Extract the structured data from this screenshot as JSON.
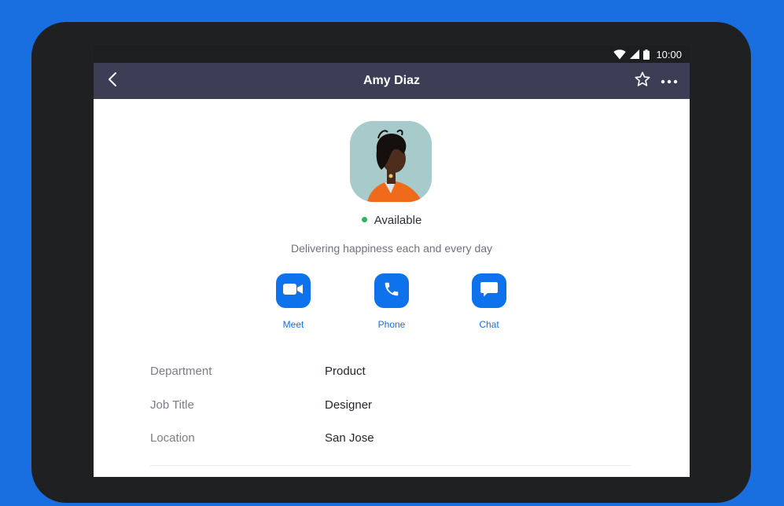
{
  "status_bar": {
    "time": "10:00",
    "icons": [
      "wifi-icon",
      "signal-icon",
      "battery-icon"
    ]
  },
  "header": {
    "title": "Amy Diaz",
    "back_icon": "chevron-left-icon",
    "star_icon": "star-outline-icon",
    "more_icon": "more-horizontal-icon"
  },
  "profile": {
    "presence": "Available",
    "presence_color": "#2fb45a",
    "status_message": "Delivering happiness each and every day"
  },
  "actions": [
    {
      "label": "Meet",
      "icon": "video-camera-icon"
    },
    {
      "label": "Phone",
      "icon": "phone-icon"
    },
    {
      "label": "Chat",
      "icon": "chat-bubble-icon"
    }
  ],
  "details": [
    {
      "key": "Department",
      "value": "Product"
    },
    {
      "key": "Job Title",
      "value": "Designer"
    },
    {
      "key": "Location",
      "value": "San Jose"
    }
  ],
  "colors": {
    "background": "#1a6fe0",
    "header": "#3b3e55",
    "accent": "#0e72ed"
  }
}
